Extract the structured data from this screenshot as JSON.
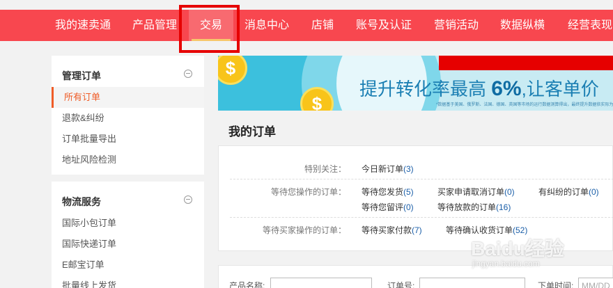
{
  "colors": {
    "nav_bg": "#f8474f",
    "active_bg": "#f86a70",
    "accent": "#ef5c27",
    "link_count": "#1a5ea8",
    "highlight": "#e60000"
  },
  "topnav": {
    "items": [
      {
        "label": "我的速卖通"
      },
      {
        "label": "产品管理"
      },
      {
        "label": "交易",
        "active": true
      },
      {
        "label": "消息中心"
      },
      {
        "label": "店铺"
      },
      {
        "label": "账号及认证"
      },
      {
        "label": "营销活动"
      },
      {
        "label": "数据纵横"
      },
      {
        "label": "经营表现"
      }
    ]
  },
  "sidebar": {
    "sections": [
      {
        "title": "管理订单",
        "icon": "collapse-icon",
        "items": [
          "所有订单",
          "退款&纠纷",
          "订单批量导出",
          "地址风险检测"
        ],
        "active_index": 0
      },
      {
        "title": "物流服务",
        "icon": "collapse-icon",
        "items": [
          "国际小包订单",
          "国际快递订单",
          "E邮宝订单",
          "批量线上发货"
        ]
      }
    ]
  },
  "banner": {
    "headline_prefix": "提升转化率最高 ",
    "headline_number": "6%",
    "headline_suffix": ",让客单价",
    "fine_print": "*数据基于美国、俄罗斯、法国、德国、英国等市场的运行数据测算得出，最终提升数据依实际为准。",
    "coin_symbol": "$"
  },
  "main": {
    "title": "我的订单",
    "rows": [
      {
        "label": "特别关注：",
        "links": [
          {
            "text": "今日新订单",
            "count": "(3)"
          }
        ]
      },
      {
        "label": "等待您操作的订单：",
        "links": [
          {
            "text": "等待您发货",
            "count": "(5)"
          },
          {
            "text": "买家申请取消订单",
            "count": "(0)"
          },
          {
            "text": "有纠纷的订单",
            "count": "(0)"
          },
          {
            "text": "等待您留评",
            "count": "(0)"
          },
          {
            "text": "等待放款的订单",
            "count": "(16)"
          }
        ]
      },
      {
        "label": "等待买家操作的订单：",
        "links": [
          {
            "text": "等待买家付款",
            "count": "(7)"
          },
          {
            "text": "等待确认收货订单",
            "count": "(52)"
          }
        ]
      }
    ]
  },
  "search": {
    "product_label": "产品名称:",
    "order_label": "订单号:",
    "time_label": "下单时间:",
    "time_placeholder": "MM/DD"
  },
  "watermark": {
    "text": "Baidu经验",
    "sub": "jingyan.baidu.com"
  }
}
